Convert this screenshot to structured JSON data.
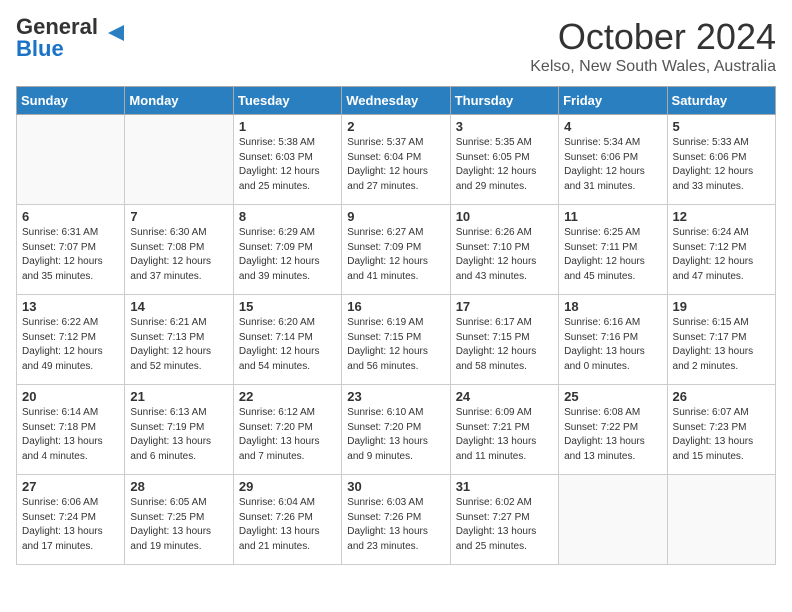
{
  "header": {
    "logo_general": "General",
    "logo_blue": "Blue",
    "month": "October 2024",
    "location": "Kelso, New South Wales, Australia"
  },
  "weekdays": [
    "Sunday",
    "Monday",
    "Tuesday",
    "Wednesday",
    "Thursday",
    "Friday",
    "Saturday"
  ],
  "weeks": [
    [
      {
        "day": "",
        "info": ""
      },
      {
        "day": "",
        "info": ""
      },
      {
        "day": "1",
        "info": "Sunrise: 5:38 AM\nSunset: 6:03 PM\nDaylight: 12 hours\nand 25 minutes."
      },
      {
        "day": "2",
        "info": "Sunrise: 5:37 AM\nSunset: 6:04 PM\nDaylight: 12 hours\nand 27 minutes."
      },
      {
        "day": "3",
        "info": "Sunrise: 5:35 AM\nSunset: 6:05 PM\nDaylight: 12 hours\nand 29 minutes."
      },
      {
        "day": "4",
        "info": "Sunrise: 5:34 AM\nSunset: 6:06 PM\nDaylight: 12 hours\nand 31 minutes."
      },
      {
        "day": "5",
        "info": "Sunrise: 5:33 AM\nSunset: 6:06 PM\nDaylight: 12 hours\nand 33 minutes."
      }
    ],
    [
      {
        "day": "6",
        "info": "Sunrise: 6:31 AM\nSunset: 7:07 PM\nDaylight: 12 hours\nand 35 minutes."
      },
      {
        "day": "7",
        "info": "Sunrise: 6:30 AM\nSunset: 7:08 PM\nDaylight: 12 hours\nand 37 minutes."
      },
      {
        "day": "8",
        "info": "Sunrise: 6:29 AM\nSunset: 7:09 PM\nDaylight: 12 hours\nand 39 minutes."
      },
      {
        "day": "9",
        "info": "Sunrise: 6:27 AM\nSunset: 7:09 PM\nDaylight: 12 hours\nand 41 minutes."
      },
      {
        "day": "10",
        "info": "Sunrise: 6:26 AM\nSunset: 7:10 PM\nDaylight: 12 hours\nand 43 minutes."
      },
      {
        "day": "11",
        "info": "Sunrise: 6:25 AM\nSunset: 7:11 PM\nDaylight: 12 hours\nand 45 minutes."
      },
      {
        "day": "12",
        "info": "Sunrise: 6:24 AM\nSunset: 7:12 PM\nDaylight: 12 hours\nand 47 minutes."
      }
    ],
    [
      {
        "day": "13",
        "info": "Sunrise: 6:22 AM\nSunset: 7:12 PM\nDaylight: 12 hours\nand 49 minutes."
      },
      {
        "day": "14",
        "info": "Sunrise: 6:21 AM\nSunset: 7:13 PM\nDaylight: 12 hours\nand 52 minutes."
      },
      {
        "day": "15",
        "info": "Sunrise: 6:20 AM\nSunset: 7:14 PM\nDaylight: 12 hours\nand 54 minutes."
      },
      {
        "day": "16",
        "info": "Sunrise: 6:19 AM\nSunset: 7:15 PM\nDaylight: 12 hours\nand 56 minutes."
      },
      {
        "day": "17",
        "info": "Sunrise: 6:17 AM\nSunset: 7:15 PM\nDaylight: 12 hours\nand 58 minutes."
      },
      {
        "day": "18",
        "info": "Sunrise: 6:16 AM\nSunset: 7:16 PM\nDaylight: 13 hours\nand 0 minutes."
      },
      {
        "day": "19",
        "info": "Sunrise: 6:15 AM\nSunset: 7:17 PM\nDaylight: 13 hours\nand 2 minutes."
      }
    ],
    [
      {
        "day": "20",
        "info": "Sunrise: 6:14 AM\nSunset: 7:18 PM\nDaylight: 13 hours\nand 4 minutes."
      },
      {
        "day": "21",
        "info": "Sunrise: 6:13 AM\nSunset: 7:19 PM\nDaylight: 13 hours\nand 6 minutes."
      },
      {
        "day": "22",
        "info": "Sunrise: 6:12 AM\nSunset: 7:20 PM\nDaylight: 13 hours\nand 7 minutes."
      },
      {
        "day": "23",
        "info": "Sunrise: 6:10 AM\nSunset: 7:20 PM\nDaylight: 13 hours\nand 9 minutes."
      },
      {
        "day": "24",
        "info": "Sunrise: 6:09 AM\nSunset: 7:21 PM\nDaylight: 13 hours\nand 11 minutes."
      },
      {
        "day": "25",
        "info": "Sunrise: 6:08 AM\nSunset: 7:22 PM\nDaylight: 13 hours\nand 13 minutes."
      },
      {
        "day": "26",
        "info": "Sunrise: 6:07 AM\nSunset: 7:23 PM\nDaylight: 13 hours\nand 15 minutes."
      }
    ],
    [
      {
        "day": "27",
        "info": "Sunrise: 6:06 AM\nSunset: 7:24 PM\nDaylight: 13 hours\nand 17 minutes."
      },
      {
        "day": "28",
        "info": "Sunrise: 6:05 AM\nSunset: 7:25 PM\nDaylight: 13 hours\nand 19 minutes."
      },
      {
        "day": "29",
        "info": "Sunrise: 6:04 AM\nSunset: 7:26 PM\nDaylight: 13 hours\nand 21 minutes."
      },
      {
        "day": "30",
        "info": "Sunrise: 6:03 AM\nSunset: 7:26 PM\nDaylight: 13 hours\nand 23 minutes."
      },
      {
        "day": "31",
        "info": "Sunrise: 6:02 AM\nSunset: 7:27 PM\nDaylight: 13 hours\nand 25 minutes."
      },
      {
        "day": "",
        "info": ""
      },
      {
        "day": "",
        "info": ""
      }
    ]
  ]
}
